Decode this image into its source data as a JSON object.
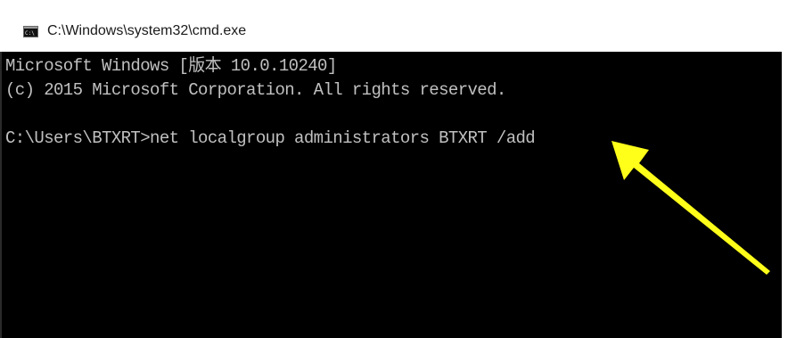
{
  "window": {
    "title": "C:\\Windows\\system32\\cmd.exe",
    "icon": "cmd-icon"
  },
  "console": {
    "lines": [
      "Microsoft Windows [版本 10.0.10240]",
      "(c) 2015 Microsoft Corporation. All rights reserved.",
      "C:\\Users\\BTXRT>net localgroup administrators BTXRT /add"
    ],
    "text_color": "#c0c0c0",
    "background_color": "#000000"
  },
  "annotation": {
    "type": "arrow",
    "color": "#ffff1a"
  }
}
